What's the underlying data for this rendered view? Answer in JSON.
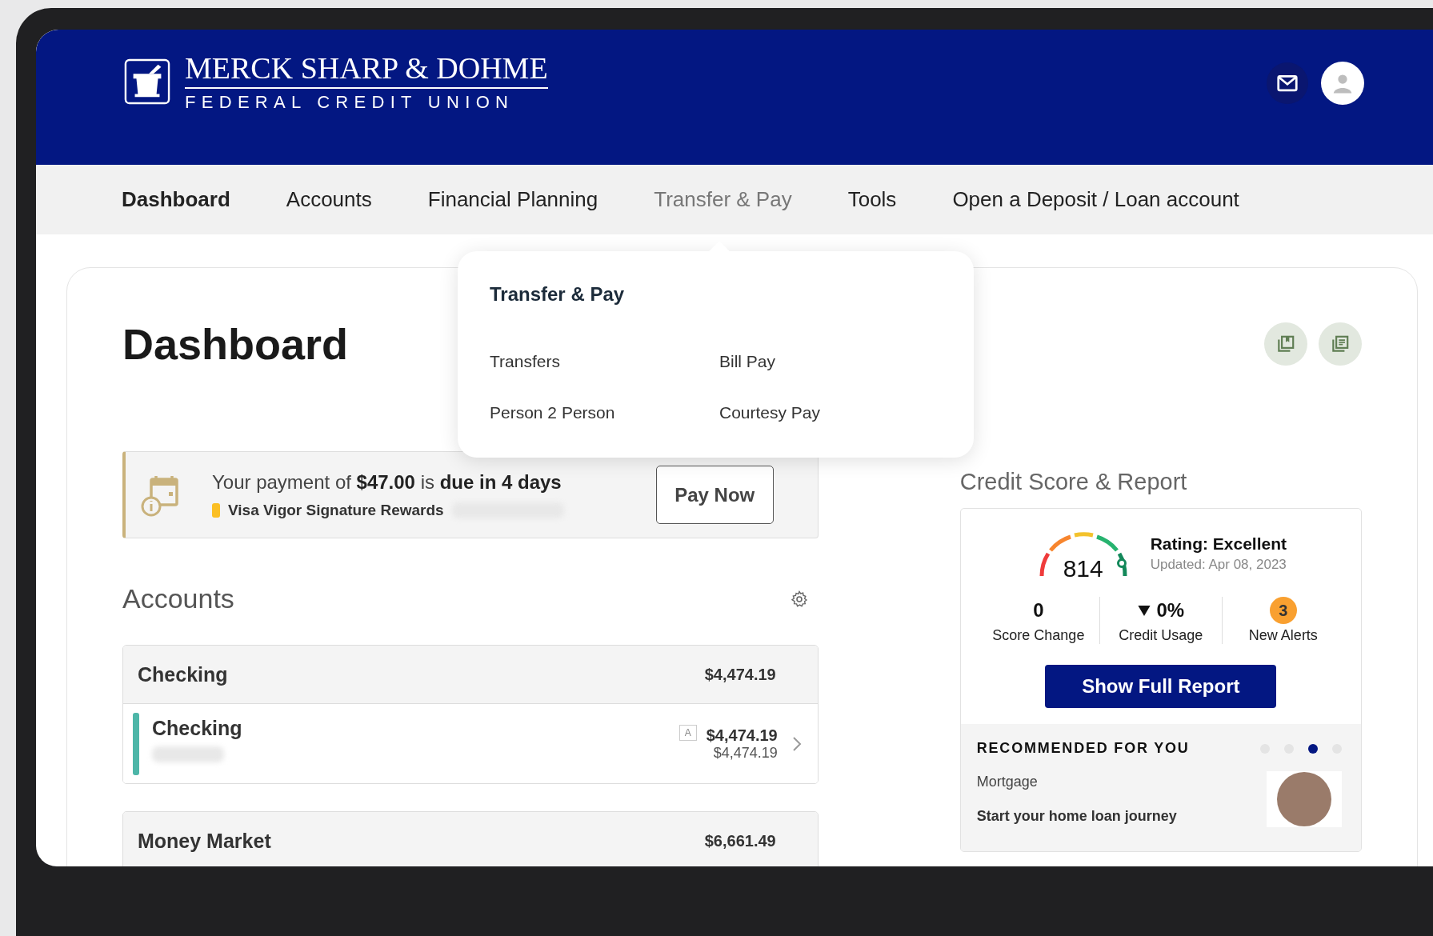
{
  "header": {
    "logo_title": "MERCK SHARP & DOHME",
    "logo_subtitle": "FEDERAL CREDIT UNION"
  },
  "nav": [
    {
      "label": "Dashboard",
      "selected": true,
      "expanded": false
    },
    {
      "label": "Accounts",
      "selected": false,
      "expanded": false
    },
    {
      "label": "Financial Planning",
      "selected": false,
      "expanded": false
    },
    {
      "label": "Transfer & Pay",
      "selected": false,
      "expanded": true
    },
    {
      "label": "Tools",
      "selected": false,
      "expanded": false
    },
    {
      "label": "Open a Deposit / Loan account",
      "selected": false,
      "expanded": false
    }
  ],
  "dropdown": {
    "title": "Transfer & Pay",
    "items": [
      "Transfers",
      "Bill Pay",
      "Person 2 Person",
      "Courtesy Pay"
    ]
  },
  "page_title": "Dashboard",
  "payment_alert": {
    "message": "Your payment of **$47.00** is **due in 4 days**",
    "account": "Visa Vigor Signature Rewards",
    "color": "#fbbf24",
    "button": "Pay Now"
  },
  "accounts": {
    "title": "Accounts",
    "groups": [
      {
        "name": "Checking",
        "total": "$4,474.19",
        "accounts": [
          {
            "name": "Checking",
            "badge": "A",
            "balance": "$4,474.19",
            "available": "$4,474.19",
            "color": "#4db6a8"
          }
        ]
      },
      {
        "name": "Money Market",
        "total": "$6,661.49"
      }
    ]
  },
  "credit": {
    "title": "Credit Score & Report",
    "score": "814",
    "rating": "Rating: Excellent",
    "updated": "Updated: Apr 08, 2023",
    "stats": [
      {
        "kind": "plain",
        "value": "0",
        "label": "Score Change"
      },
      {
        "kind": "down",
        "value": "0%",
        "label": "Credit Usage"
      },
      {
        "kind": "badge",
        "value": "3",
        "label": "New Alerts"
      }
    ],
    "button": "Show Full Report"
  },
  "recommended": {
    "title": "RECOMMENDED FOR YOU",
    "dots": [
      {
        "selected": false
      },
      {
        "selected": false
      },
      {
        "selected": true
      },
      {
        "selected": false
      }
    ],
    "category": "Mortgage",
    "headline": "Start your home loan journey"
  }
}
